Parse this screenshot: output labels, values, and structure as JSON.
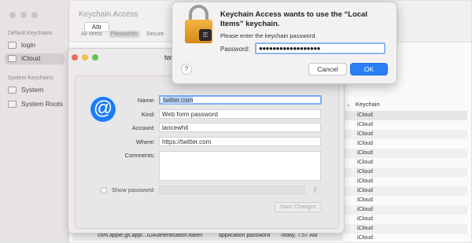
{
  "colors": {
    "accent": "#2a7ff5",
    "traffic_red": "#ee6a5f",
    "traffic_yellow": "#f5bd4f",
    "traffic_green": "#61c454"
  },
  "main_window": {
    "title": "Keychain Access",
    "category_tabs": [
      "All Items",
      "Passwords",
      "Secure"
    ],
    "sidebar": {
      "default_keychains_label": "Default Keychains",
      "default_items": [
        "login",
        "iCloud"
      ],
      "system_keychains_label": "System Keychains",
      "system_items": [
        "System",
        "System Roots"
      ]
    },
    "column_header": "Keychain",
    "keychain_cells": [
      "iCloud",
      "iCloud",
      "iCloud",
      "iCloud",
      "iCloud",
      "iCloud",
      "iCloud",
      "iCloud",
      "iCloud",
      "iCloud",
      "iCloud",
      "iCloud",
      "iCloud",
      "iCloud"
    ],
    "bottom_row": {
      "name": "com.apple.gs.appl...IDAuthentication.token",
      "kind": "application password",
      "date": "Today, 7:57 AM",
      "keychain": "iCloud"
    }
  },
  "detail_window": {
    "title_fragment": "tw",
    "tab_fragment": "Attr",
    "icon": "at-sign-icon",
    "fields": {
      "name_label": "Name:",
      "name_value": "twitter.com",
      "kind_label": "Kind:",
      "kind_value": "Web form password",
      "account_label": "Account:",
      "account_value": "lancewhit",
      "where_label": "Where:",
      "where_value": "https://twitter.com",
      "comments_label": "Comments:"
    },
    "show_password_label": "Show password:",
    "save_button": "Save Changes"
  },
  "dialog": {
    "icon": "lock-icon",
    "title": "Keychain Access wants to use the “Local Items” keychain.",
    "message": "Please enter the keychain password.",
    "password_label": "Password:",
    "password_value": "●●●●●●●●●●●●●●●●●●",
    "help_label": "?",
    "cancel_label": "Cancel",
    "ok_label": "OK"
  }
}
